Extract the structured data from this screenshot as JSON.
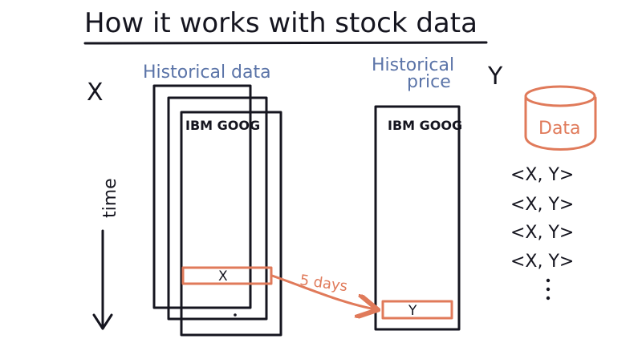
{
  "title": "How it works with stock data",
  "left_axis_label": "X",
  "right_axis_label": "Y",
  "time_label": "time",
  "historical_data_label": "Historical data",
  "historical_price_label_line1": "Historical",
  "historical_price_label_line2": "price",
  "left_table_header": "IBM GOOG",
  "right_table_header": "IBM GOOG",
  "x_cell_label": "X",
  "y_cell_label": "Y",
  "arrow_label": "5 days",
  "database_label": "Data",
  "pairs": [
    "<X, Y>",
    "<X, Y>",
    "<X, Y>",
    "<X, Y>"
  ],
  "colors": {
    "ink": "#15151f",
    "blue": "#5b74a8",
    "orange": "#e07a5a"
  }
}
